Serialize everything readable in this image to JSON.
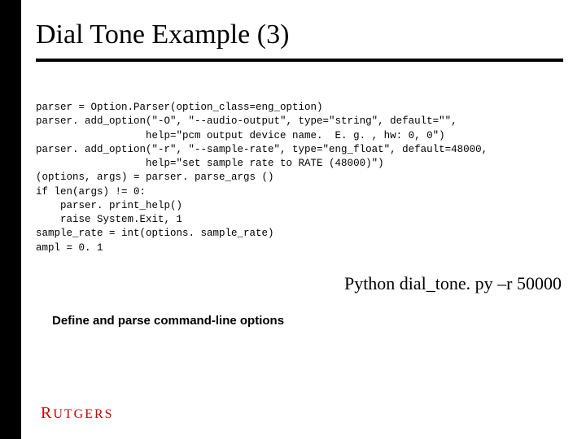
{
  "title": "Dial Tone Example (3)",
  "code": "parser = Option.Parser(option_class=eng_option)\nparser. add_option(\"-O\", \"--audio-output\", type=\"string\", default=\"\",\n                  help=\"pcm output device name.  E. g. , hw: 0, 0\")\nparser. add_option(\"-r\", \"--sample-rate\", type=\"eng_float\", default=48000,\n                  help=\"set sample rate to RATE (48000)\")\n(options, args) = parser. parse_args ()\nif len(args) != 0:\n    parser. print_help()\n    raise System.Exit, 1\nsample_rate = int(options. sample_rate)\nampl = 0. 1",
  "command": "Python dial_tone. py –r 50000",
  "caption": "Define and parse command-line options",
  "logo": {
    "first": "R",
    "rest": "UTGERS"
  }
}
